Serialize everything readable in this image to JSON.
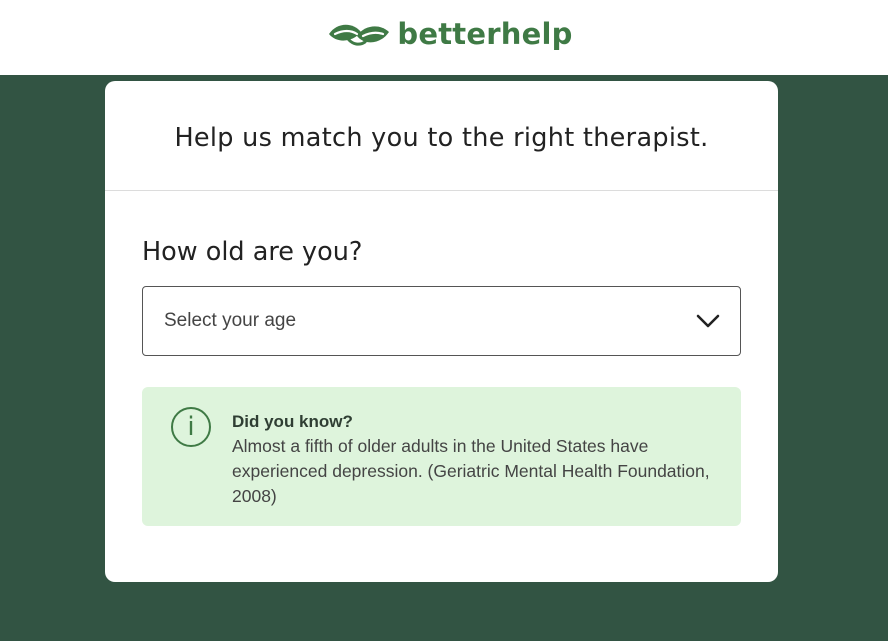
{
  "brand": {
    "name": "betterhelp",
    "logo_icon": "leaves-logo-icon",
    "color": "#3f7a45",
    "background": "#325443"
  },
  "card": {
    "title": "Help us match you to the right therapist."
  },
  "question": {
    "label": "How old are you?",
    "select_placeholder": "Select your age",
    "select_icon": "chevron-down-icon"
  },
  "info": {
    "icon": "info-icon",
    "icon_glyph": "i",
    "title": "Did you know?",
    "text": "Almost a fifth of older adults in the United States have experienced depression. (Geriatric Mental Health Foundation, 2008)",
    "background": "#def4dc"
  }
}
